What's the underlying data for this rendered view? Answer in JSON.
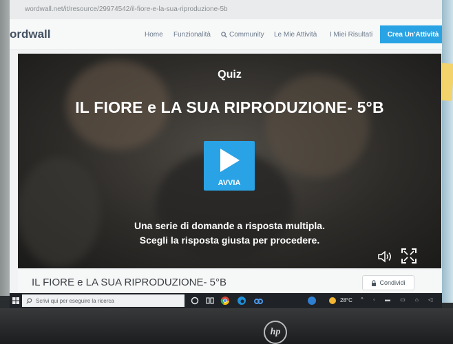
{
  "browser": {
    "url": "wordwall.net/it/resource/29974542/il-fiore-e-la-sua-riproduzione-5b"
  },
  "nav": {
    "logo": "ordwall",
    "links": [
      "Home",
      "Funzionalità",
      "Community",
      "Le Mie Attività",
      "I Miei Risultati"
    ],
    "cta": "Crea Un'Attività"
  },
  "activity": {
    "type": "Quiz",
    "title": "IL FIORE e LA SUA RIPRODUZIONE- 5°B",
    "play_label": "AVVIA",
    "description_line1": "Una serie di domande a risposta multipla.",
    "description_line2": "Scegli la risposta giusta per procedere."
  },
  "info": {
    "title": "IL FIORE e LA SUA RIPRODUZIONE- 5°B",
    "share_label": "Condividi"
  },
  "taskbar": {
    "search_placeholder": "Scrivi qui per eseguire la ricerca",
    "weather": "28°C"
  },
  "colors": {
    "accent": "#29a3e3",
    "player_bg": "#2e2c29",
    "taskbar_bg": "#1f2227"
  }
}
